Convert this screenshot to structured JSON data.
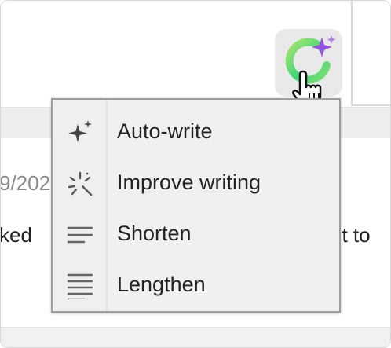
{
  "background": {
    "partial_date": "9/202",
    "partial_text_left": "ked",
    "partial_text_right": "nt to"
  },
  "ai_button": {
    "icon": "ai-sparkle-ring-icon",
    "ring_colors": [
      "#3fd879",
      "#a8e36b"
    ],
    "sparkle_color": "#9b4ee6"
  },
  "cursor": {
    "icon": "hand-pointer-icon"
  },
  "menu": {
    "items": [
      {
        "label": "Auto-write",
        "icon": "sparkle-icon"
      },
      {
        "label": "Improve writing",
        "icon": "magic-burst-icon"
      },
      {
        "label": "Shorten",
        "icon": "short-lines-icon"
      },
      {
        "label": "Lengthen",
        "icon": "long-lines-icon"
      }
    ]
  }
}
